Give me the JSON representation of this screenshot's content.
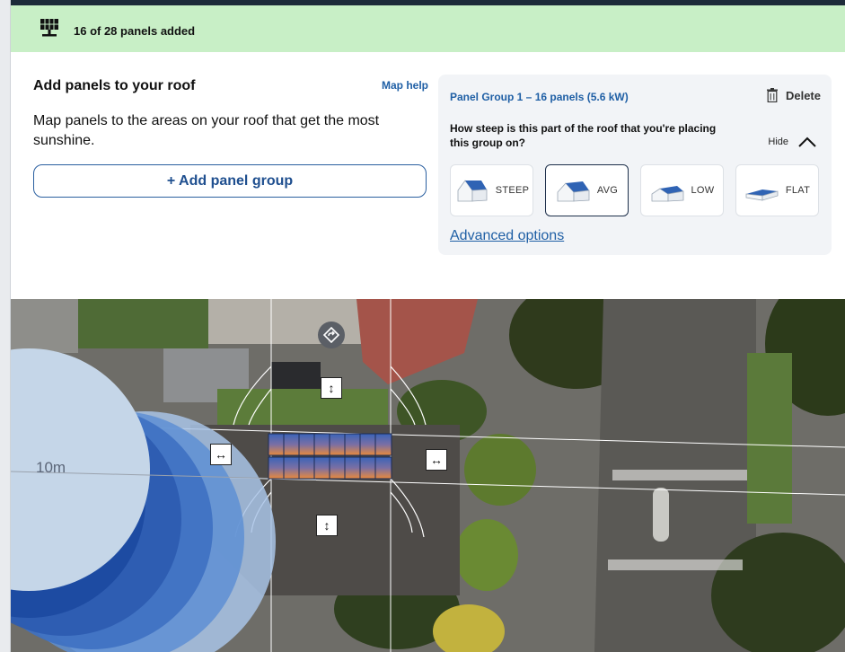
{
  "banner": {
    "icon": "solar-panel-icon",
    "text": "16 of 28 panels added",
    "bg_color": "#c8efc6"
  },
  "left_panel": {
    "heading": "Add panels to your roof",
    "map_help": "Map help",
    "description": "Map panels to the areas on your roof that get the most sunshine.",
    "add_group_label": "+ Add panel group"
  },
  "panel_group": {
    "title": "Panel Group 1 – 16 panels (5.6 kW)",
    "delete_label": "Delete",
    "question": "How steep is this part of the roof that you're placing this group on?",
    "hide_label": "Hide",
    "options": [
      {
        "label": "STEEP",
        "selected": false
      },
      {
        "label": "AVG",
        "selected": true
      },
      {
        "label": "LOW",
        "selected": false
      },
      {
        "label": "FLAT",
        "selected": false
      }
    ],
    "advanced_label": "Advanced options"
  },
  "map": {
    "distance_label": "10m",
    "horizontal_arrow": "↔",
    "vertical_arrow": "↕"
  },
  "colors": {
    "accent": "#1f5fa5",
    "panel_blue": "#3a63b8",
    "panel_orange": "#e98a3c"
  }
}
